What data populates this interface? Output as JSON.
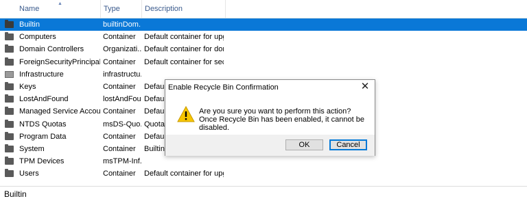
{
  "columns": {
    "name": "Name",
    "type": "Type",
    "description": "Description"
  },
  "rows": [
    {
      "name": "Builtin",
      "type": "builtinDom...",
      "description": "",
      "icon": "folder-icon",
      "selected": true
    },
    {
      "name": "Computers",
      "type": "Container",
      "description": "Default container for upgr...",
      "icon": "folder-icon"
    },
    {
      "name": "Domain Controllers",
      "type": "Organizati...",
      "description": "Default container for dom...",
      "icon": "folder-icon"
    },
    {
      "name": "ForeignSecurityPrincipals",
      "type": "Container",
      "description": "Default container for secur...",
      "icon": "folder-icon"
    },
    {
      "name": "Infrastructure",
      "type": "infrastructu...",
      "description": "",
      "icon": "infrastructure-icon"
    },
    {
      "name": "Keys",
      "type": "Container",
      "description": "Default",
      "icon": "folder-icon"
    },
    {
      "name": "LostAndFound",
      "type": "lostAndFou...",
      "description": "Default",
      "icon": "folder-icon"
    },
    {
      "name": "Managed Service Accounts",
      "type": "Container",
      "description": "Default",
      "icon": "folder-icon"
    },
    {
      "name": "NTDS Quotas",
      "type": "msDS-Quo...",
      "description": "Quota s",
      "icon": "folder-icon"
    },
    {
      "name": "Program Data",
      "type": "Container",
      "description": "Default",
      "icon": "folder-icon"
    },
    {
      "name": "System",
      "type": "Container",
      "description": "Builtin s",
      "icon": "folder-icon"
    },
    {
      "name": "TPM Devices",
      "type": "msTPM-Inf...",
      "description": "",
      "icon": "folder-icon"
    },
    {
      "name": "Users",
      "type": "Container",
      "description": "Default container for upgr...",
      "icon": "folder-icon"
    }
  ],
  "status": {
    "text": "Builtin"
  },
  "dialog": {
    "title": "Enable Recycle Bin Confirmation",
    "message": "Are you sure you want to perform this action? Once Recycle Bin has been enabled, it cannot be disabled.",
    "ok_label": "OK",
    "cancel_label": "Cancel",
    "close_glyph": "✕",
    "icon": "warning-icon"
  },
  "colors": {
    "selection": "#0a78d7",
    "header_text": "#3a5a8c",
    "warning": "#f7c600"
  }
}
